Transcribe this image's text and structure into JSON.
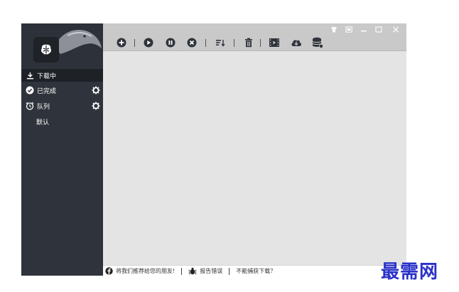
{
  "sidebar": {
    "items": [
      {
        "label": "下载中",
        "icon": "download-icon"
      },
      {
        "label": "已完成",
        "icon": "check-circle-icon"
      },
      {
        "label": "队列",
        "icon": "alarm-clock-icon"
      }
    ],
    "queue_default": "默认"
  },
  "toolbar": {
    "buttons": [
      "add-icon",
      "play-icon",
      "pause-icon",
      "stop-icon",
      "sort-icon",
      "delete-icon",
      "video-icon",
      "cloud-download-icon",
      "database-icon"
    ]
  },
  "window_controls": [
    "skin-icon",
    "mini-icon",
    "minimize-icon",
    "maximize-icon",
    "close-icon"
  ],
  "statusbar": {
    "recommend": "将我们推荐给您的朋友!",
    "report": "报告错误",
    "cannot_capture": "不能捕获下载？"
  },
  "watermark": "最需网",
  "colors": {
    "sidebar_bg": "#2f333b",
    "toolbar_bg": "#c9c9c9",
    "content_bg": "#e4e4e4",
    "watermark": "#2a31c8"
  }
}
